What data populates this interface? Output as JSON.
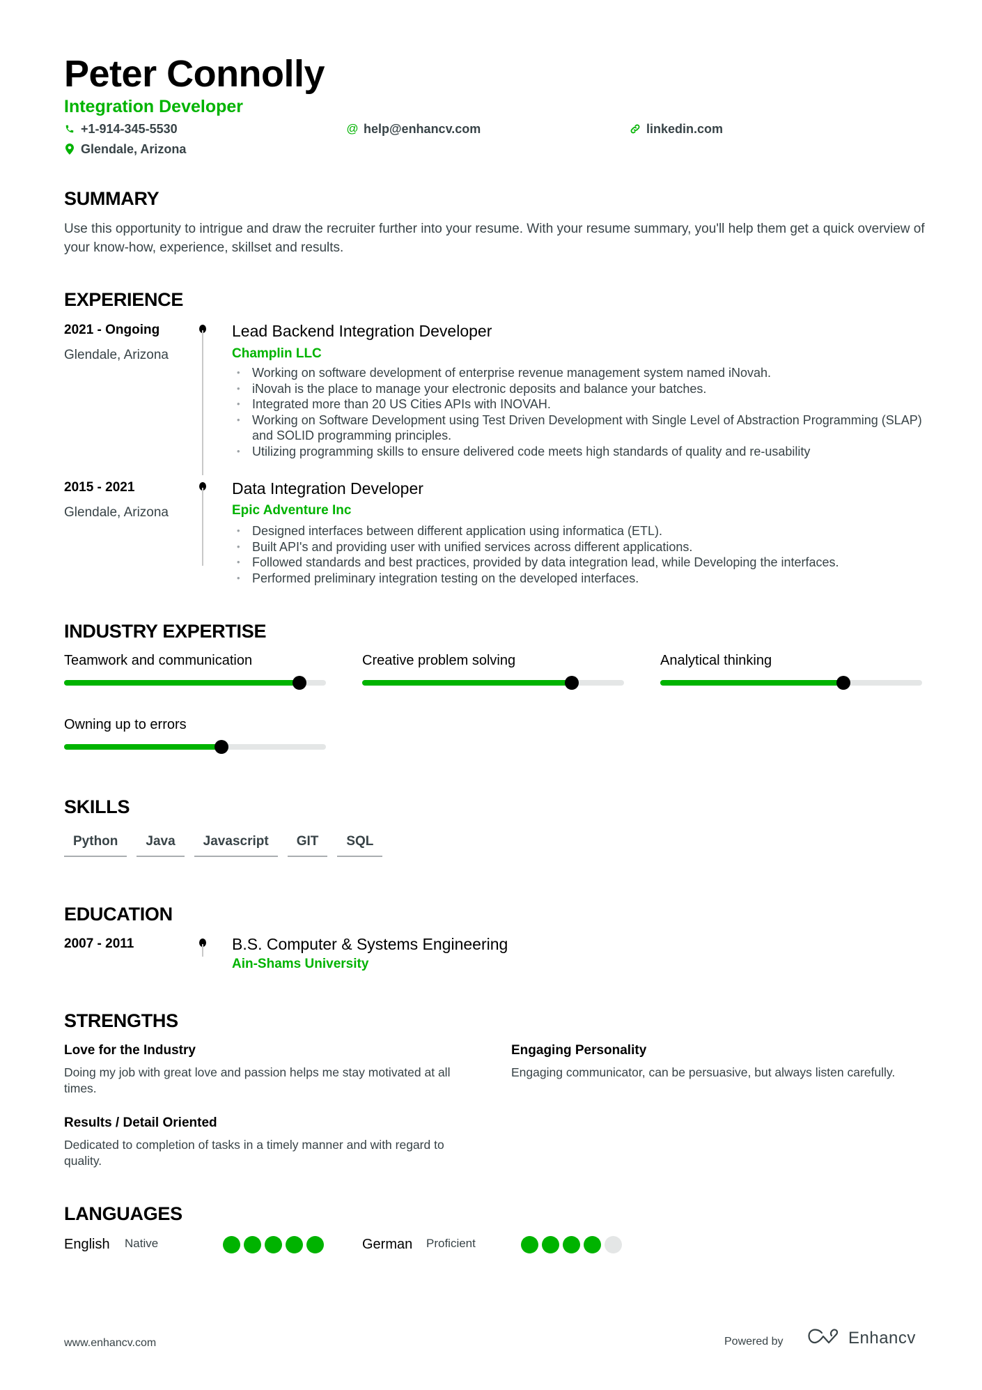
{
  "header": {
    "name": "Peter Connolly",
    "title": "Integration Developer",
    "contacts": {
      "phone": {
        "icon": "phone-icon",
        "value": "+1-914-345-5530"
      },
      "email": {
        "icon": "at-icon",
        "value": "help@enhancv.com"
      },
      "link": {
        "icon": "link-icon",
        "value": "linkedin.com"
      },
      "location": {
        "icon": "location-pin-icon",
        "value": "Glendale, Arizona"
      }
    }
  },
  "colors": {
    "accent": "#00b300",
    "text_secondary": "#384347",
    "track": "#e4e6e6"
  },
  "summary": {
    "heading": "SUMMARY",
    "text": "Use this opportunity to intrigue and draw the recruiter further into your resume. With your resume summary, you'll help them get a quick overview of your know-how, experience, skillset and results."
  },
  "experience": {
    "heading": "EXPERIENCE",
    "items": [
      {
        "dates": "2021 - Ongoing",
        "location": "Glendale, Arizona",
        "role": "Lead Backend Integration Developer",
        "company": "Champlin LLC",
        "bullets": [
          "Working on software development of enterprise revenue management system named iNovah.",
          "iNovah is the place to manage your electronic deposits and balance your batches.",
          "Integrated more than 20 US Cities APIs with INOVAH.",
          "Working on Software Development using Test Driven Development with Single Level of Abstraction Programming (SLAP) and SOLID programming principles.",
          "Utilizing programming skills to ensure delivered code meets high standards of quality and re-usability"
        ]
      },
      {
        "dates": "2015 - 2021",
        "location": "Glendale, Arizona",
        "role": "Data Integration Developer",
        "company": "Epic Adventure Inc",
        "bullets": [
          "Designed interfaces between different application using informatica (ETL).",
          "Built API's and providing user with unified services across different applications.",
          "Followed standards and best practices, provided by data integration lead, while Developing the interfaces.",
          "Performed preliminary integration testing on the developed interfaces."
        ]
      }
    ]
  },
  "expertise": {
    "heading": "INDUSTRY EXPERTISE",
    "items": [
      {
        "label": "Teamwork and communication",
        "level": 0.9
      },
      {
        "label": "Creative problem solving",
        "level": 0.8
      },
      {
        "label": "Analytical thinking",
        "level": 0.7
      },
      {
        "label": "Owning up to errors",
        "level": 0.6
      }
    ]
  },
  "skills": {
    "heading": "SKILLS",
    "items": [
      "Python",
      "Java",
      "Javascript",
      "GIT",
      "SQL"
    ]
  },
  "education": {
    "heading": "EDUCATION",
    "items": [
      {
        "dates": "2007 - 2011",
        "degree": "B.S. Computer & Systems Engineering",
        "school": "Ain-Shams University"
      }
    ]
  },
  "strengths": {
    "heading": "STRENGTHS",
    "items": [
      {
        "title": "Love for the Industry",
        "description": "Doing my job with great love and passion helps me stay motivated at all times."
      },
      {
        "title": "Engaging Personality",
        "description": "Engaging communicator, can be persuasive, but always listen carefully."
      },
      {
        "title": "Results / Detail Oriented",
        "description": "Dedicated to completion of tasks in a timely manner and with regard to quality."
      }
    ]
  },
  "languages": {
    "heading": "LANGUAGES",
    "items": [
      {
        "name": "English",
        "level_label": "Native",
        "rating": 5,
        "max": 5
      },
      {
        "name": "German",
        "level_label": "Proficient",
        "rating": 4,
        "max": 5
      }
    ]
  },
  "footer": {
    "url": "www.enhancv.com",
    "powered_by": "Powered by",
    "brand": "Enhancv",
    "brand_icon": "enhancv-logo-icon"
  }
}
